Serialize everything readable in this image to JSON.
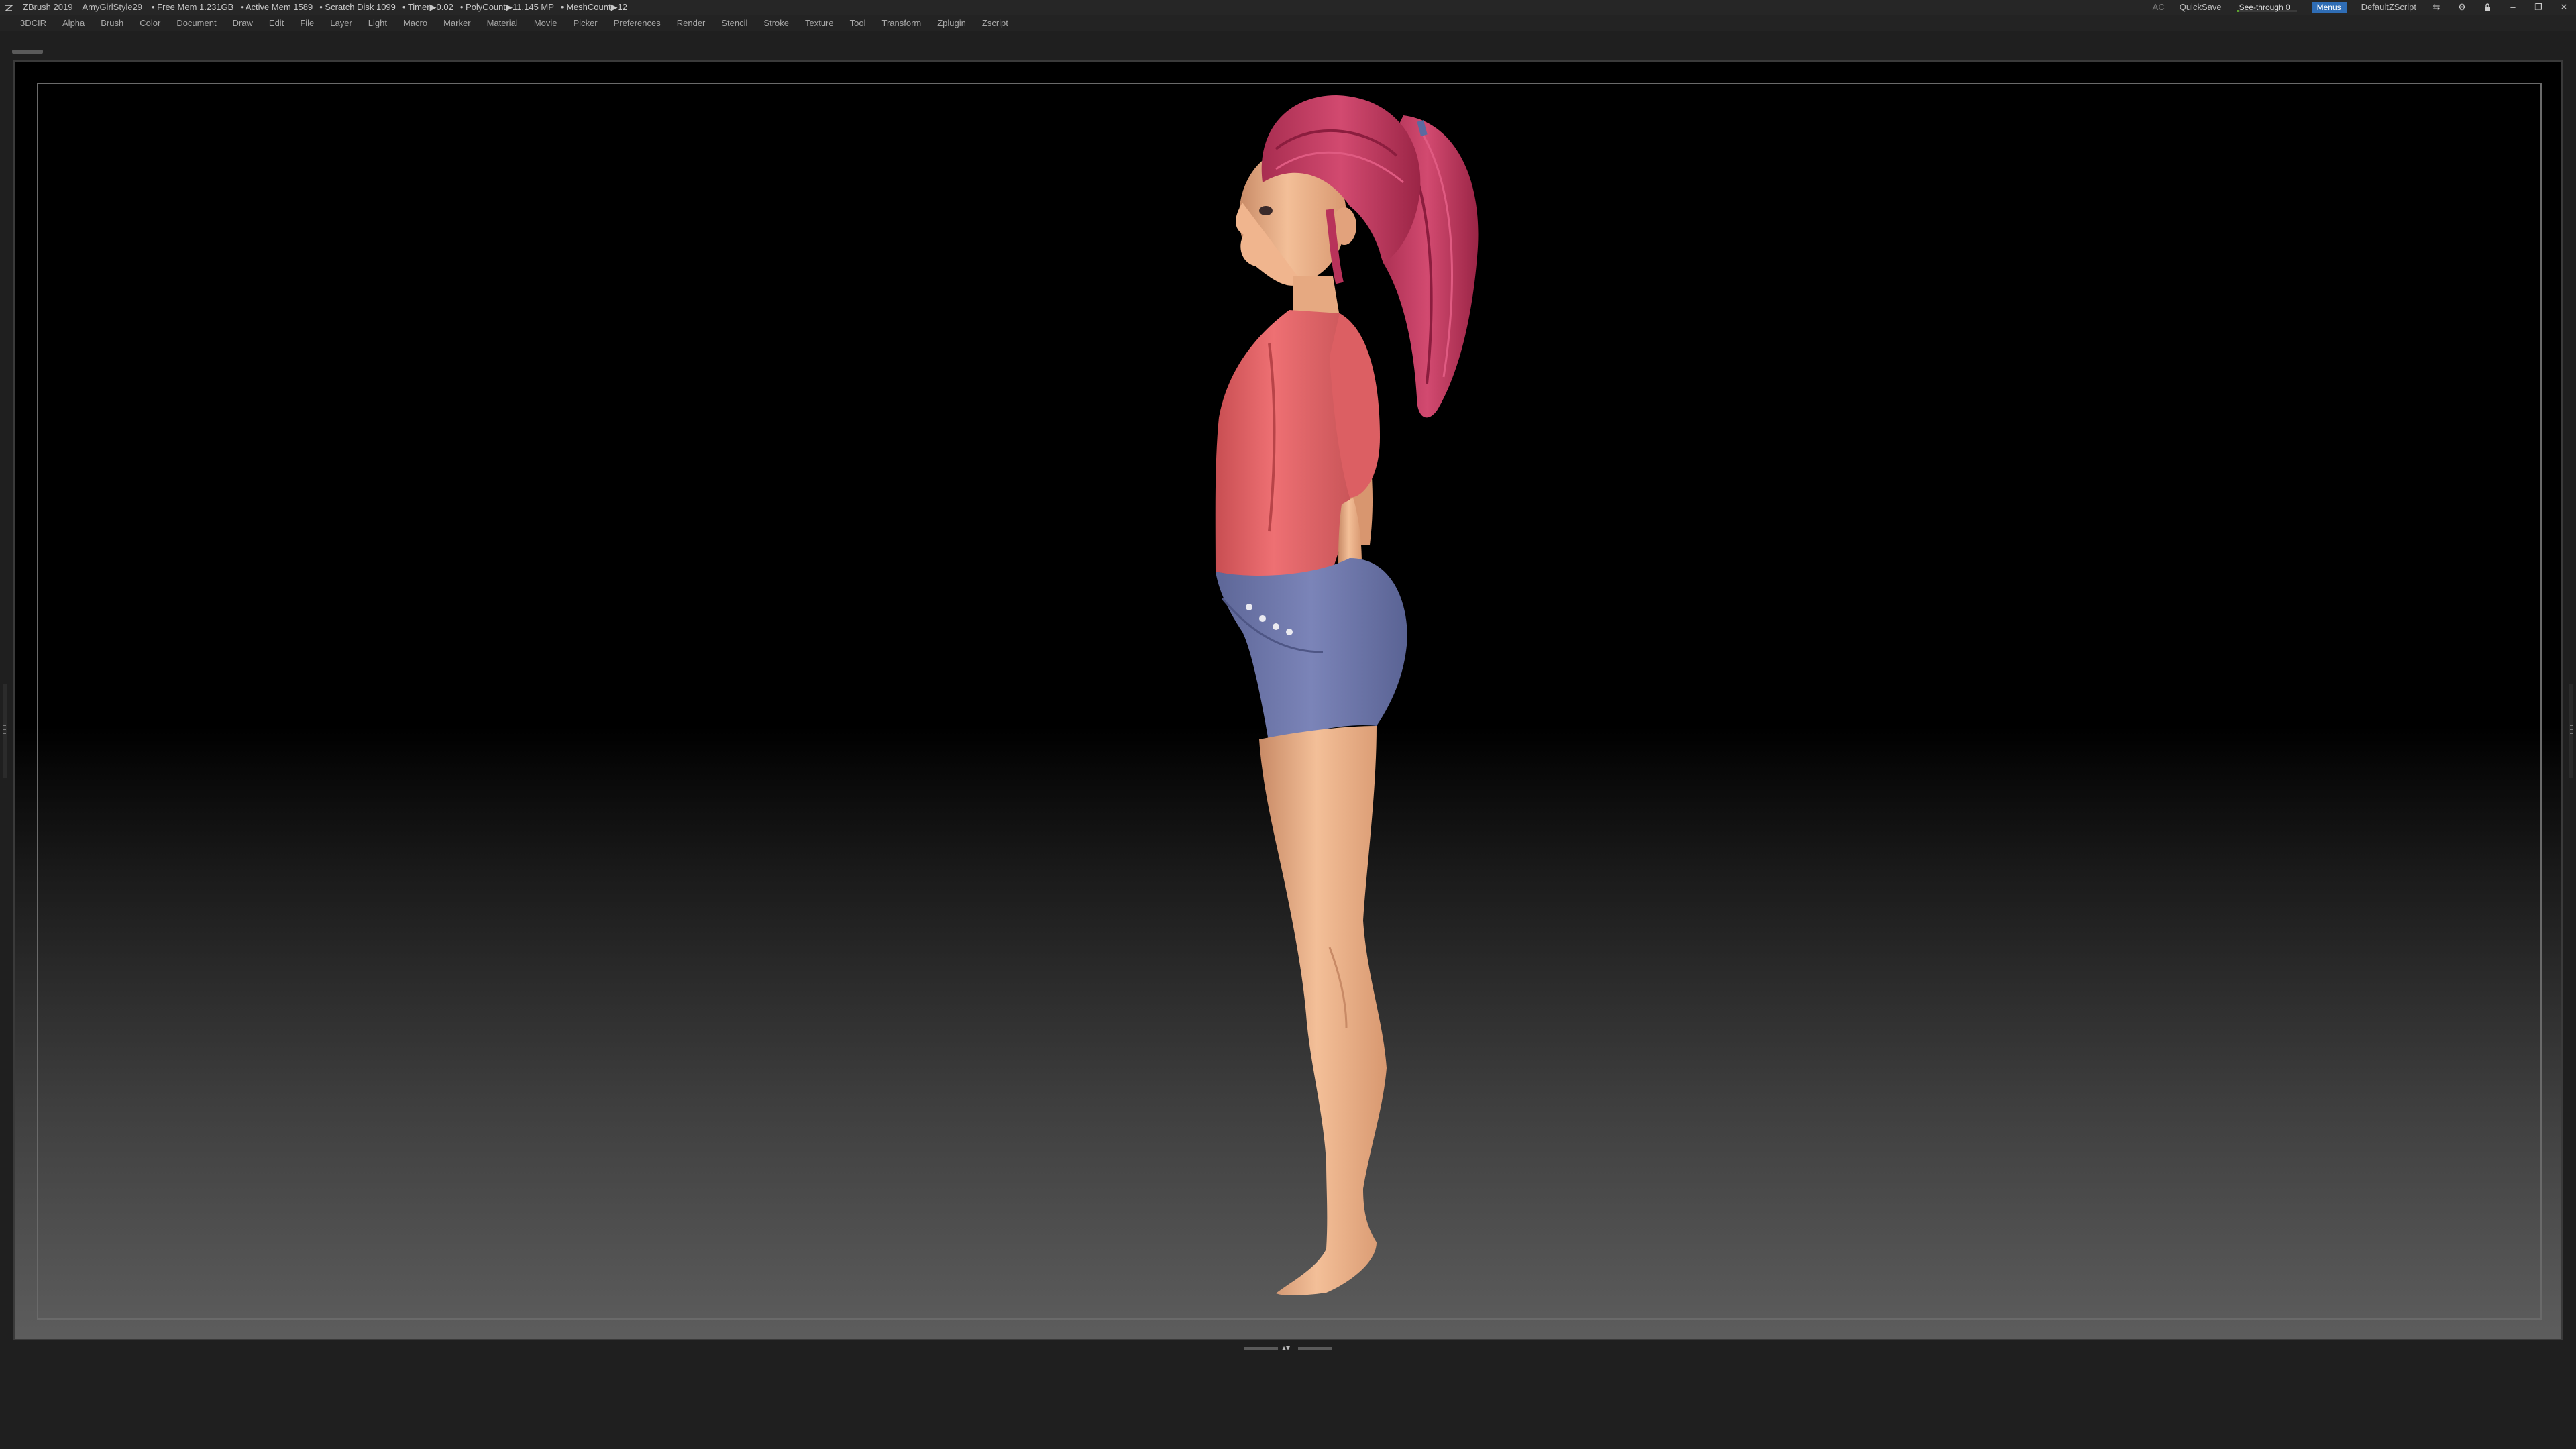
{
  "titlebar": {
    "app": "ZBrush 2019",
    "document": "AmyGirlStyle29",
    "stats": [
      "• Free Mem 1.231GB",
      "• Active Mem 1589",
      "• Scratch Disk 1099",
      "• Timer▶0.02",
      "• PolyCount▶11.145 MP",
      "• MeshCount▶12"
    ],
    "ac_label": "AC",
    "quicksave": "QuickSave",
    "seethrough": {
      "label": "See-through  0",
      "value": 0
    },
    "menus": "Menus",
    "script": "DefaultZScript"
  },
  "menubar": [
    "3DCIR",
    "Alpha",
    "Brush",
    "Color",
    "Document",
    "Draw",
    "Edit",
    "File",
    "Layer",
    "Light",
    "Macro",
    "Marker",
    "Material",
    "Movie",
    "Picker",
    "Preferences",
    "Render",
    "Stencil",
    "Stroke",
    "Texture",
    "Tool",
    "Transform",
    "Zplugin",
    "Zscript"
  ],
  "colors": {
    "accent": "#2f6db5",
    "seethrough_fill": "#5aa02c",
    "skin": "#f0b58e",
    "hair": "#c73b63",
    "shirt": "#e46568",
    "shorts": "#6d76a8"
  },
  "icons": [
    "zbrush-logo-icon",
    "layout-icon",
    "settings-icon",
    "lock-icon",
    "minimize-icon",
    "restore-icon",
    "close-icon"
  ]
}
